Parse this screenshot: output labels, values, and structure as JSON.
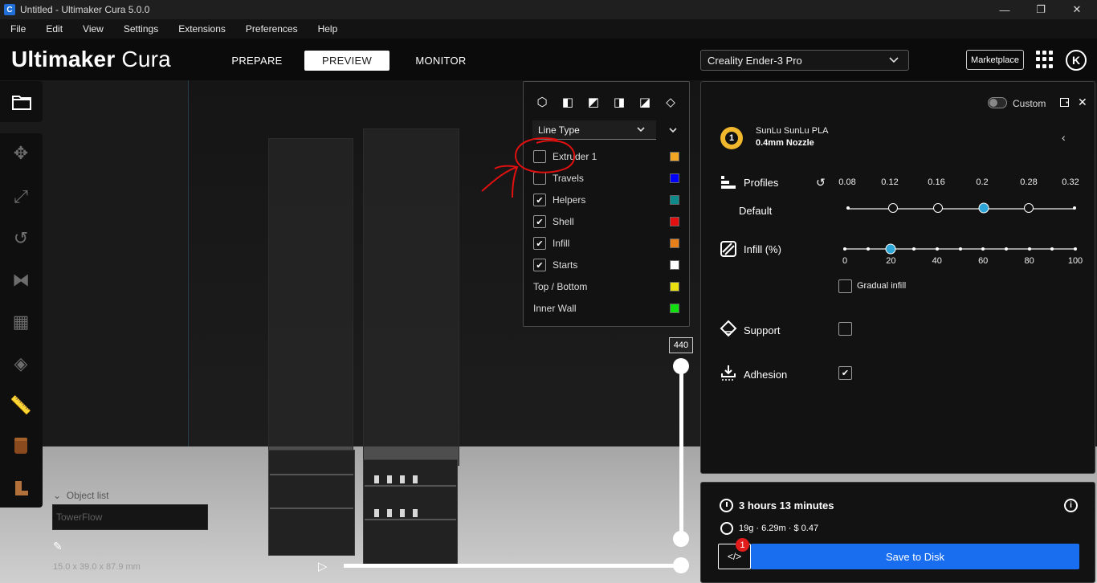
{
  "window": {
    "title": "Untitled - Ultimaker Cura 5.0.0",
    "app_icon_letter": "C",
    "controls": {
      "minimize": "—",
      "maximize": "❐",
      "close": "✕"
    }
  },
  "menu": [
    "File",
    "Edit",
    "View",
    "Settings",
    "Extensions",
    "Preferences",
    "Help"
  ],
  "header": {
    "logo_bold": "Ultimaker",
    "logo_light": " Cura",
    "tabs": [
      {
        "label": "PREPARE",
        "active": false
      },
      {
        "label": "PREVIEW",
        "active": true
      },
      {
        "label": "MONITOR",
        "active": false
      }
    ],
    "printer": "Creality Ender-3 Pro",
    "marketplace": "Marketplace",
    "account_initial": "K"
  },
  "view_panel": {
    "color_scheme": "Line Type",
    "features": [
      {
        "label": "Extruder 1",
        "checked": false,
        "has_checkbox": true,
        "color": "#f5a623"
      },
      {
        "label": "Travels",
        "checked": false,
        "has_checkbox": true,
        "color": "#0000ff"
      },
      {
        "label": "Helpers",
        "checked": true,
        "has_checkbox": true,
        "color": "#0f8a8a"
      },
      {
        "label": "Shell",
        "checked": true,
        "has_checkbox": true,
        "color": "#e21010"
      },
      {
        "label": "Infill",
        "checked": true,
        "has_checkbox": true,
        "color": "#e8801a"
      },
      {
        "label": "Starts",
        "checked": true,
        "has_checkbox": true,
        "color": "#ffffff"
      },
      {
        "label": "Top / Bottom",
        "checked": false,
        "has_checkbox": false,
        "color": "#e8e010"
      },
      {
        "label": "Inner Wall",
        "checked": false,
        "has_checkbox": false,
        "color": "#10e010"
      }
    ]
  },
  "layer_view": {
    "current_layer": "440",
    "layer_fraction": 1.0,
    "path_fraction": 1.0
  },
  "objects": {
    "list_label": "Object list",
    "selected_object": "TowerFlow",
    "dimensions": "15.0 x 39.0 x 87.9 mm"
  },
  "print_setup": {
    "custom_label": "Custom",
    "material": "SunLu SunLu PLA",
    "nozzle": "0.4mm Nozzle",
    "extruder_number": "1",
    "profiles": {
      "label": "Profiles",
      "sublabel": "Default",
      "ticks": [
        "0.08",
        "0.12",
        "0.16",
        "0.2",
        "0.28",
        "0.32"
      ],
      "available": [
        false,
        true,
        true,
        true,
        true,
        false
      ],
      "selected_index": 3
    },
    "infill": {
      "label": "Infill (%)",
      "ticks": [
        "0",
        "20",
        "40",
        "60",
        "80",
        "100"
      ],
      "value": 20,
      "gradual_label": "Gradual infill",
      "gradual_checked": false
    },
    "support": {
      "label": "Support",
      "checked": false
    },
    "adhesion": {
      "label": "Adhesion",
      "checked": true
    }
  },
  "action": {
    "print_time": "3 hours 13 minutes",
    "material_estimate": "19g · 6.29m · $ 0.47",
    "save_label": "Save to Disk",
    "badge_count": "1",
    "gcode_icon": "</>"
  }
}
